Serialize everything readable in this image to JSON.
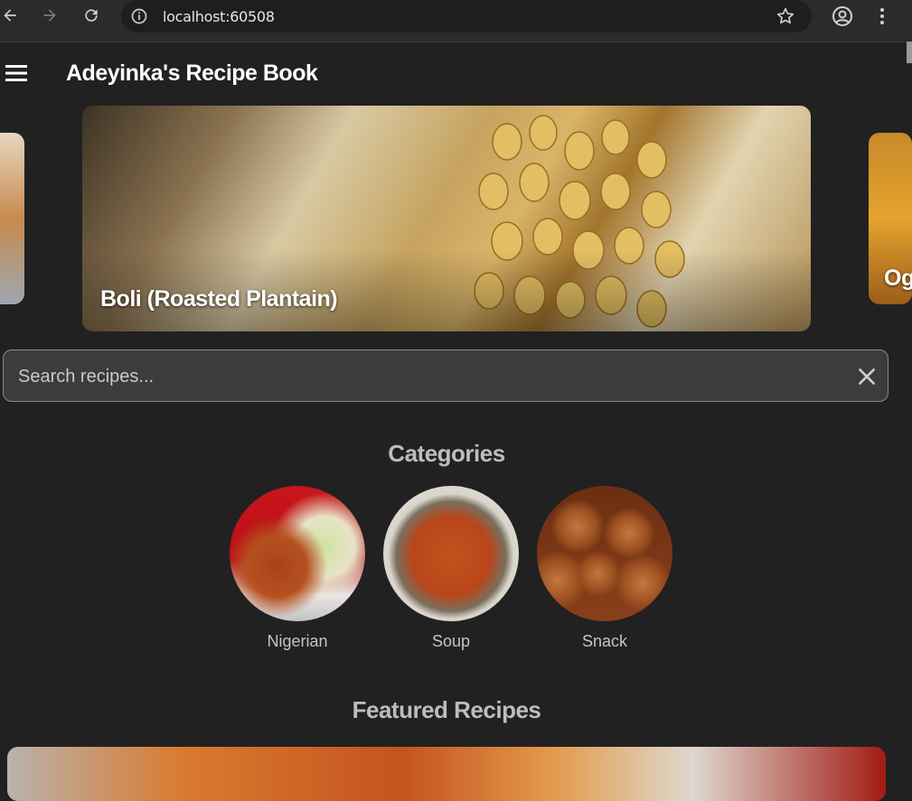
{
  "browser": {
    "url": "localhost:60508",
    "icons": [
      "back-icon",
      "forward-icon",
      "reload-icon",
      "info-icon",
      "star-icon",
      "account-icon",
      "more-vert-icon"
    ]
  },
  "app": {
    "title": "Adeyinka's Recipe Book"
  },
  "carousel": {
    "items": [
      {
        "label": ""
      },
      {
        "label": "Boli (Roasted Plantain)"
      },
      {
        "label": "Og"
      }
    ]
  },
  "search": {
    "placeholder": "Search recipes...",
    "value": ""
  },
  "categories": {
    "title": "Categories",
    "items": [
      {
        "label": "Nigerian"
      },
      {
        "label": "Soup"
      },
      {
        "label": "Snack"
      }
    ]
  },
  "featured": {
    "title": "Featured Recipes"
  },
  "colors": {
    "background": "#212121",
    "search_bg": "#3c3c3c",
    "section_title": "#bdbdbd"
  }
}
